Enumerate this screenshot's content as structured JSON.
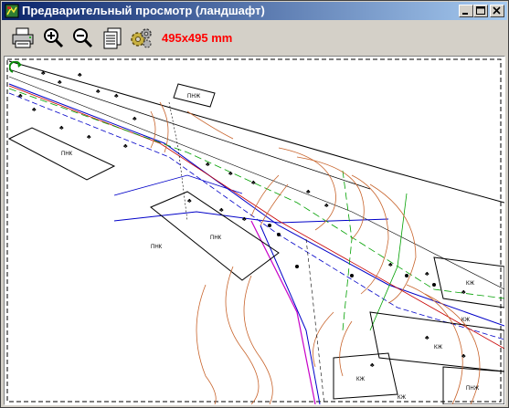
{
  "window": {
    "title": "Предварительный просмотр (ландшафт)"
  },
  "title_buttons": {
    "minimize_icon": "minimize-icon",
    "maximize_icon": "maximize-icon",
    "close_icon": "close-icon"
  },
  "toolbar": {
    "print_icon": "printer-icon",
    "zoom_in_icon": "zoom-in-icon",
    "zoom_out_icon": "zoom-out-icon",
    "pages_icon": "pages-icon",
    "settings_icon": "gears-icon",
    "page_size": "495x495 mm"
  },
  "preview": {
    "rotate_icon": "rotate-arrow-icon",
    "labels": [
      "ПНК",
      "ПНК",
      "КЖ",
      "КЖ",
      "КЖ",
      "ПНЖ",
      "ПНЖ",
      "ПНК",
      "КЖ",
      "КЖ"
    ]
  },
  "colors": {
    "title_start": "#0a246a",
    "title_end": "#a6caf0",
    "size_label": "#ff0000",
    "contour": "#c8642c",
    "road": "#0000c8",
    "green_line": "#00a000",
    "magenta_line": "#c800c8"
  }
}
